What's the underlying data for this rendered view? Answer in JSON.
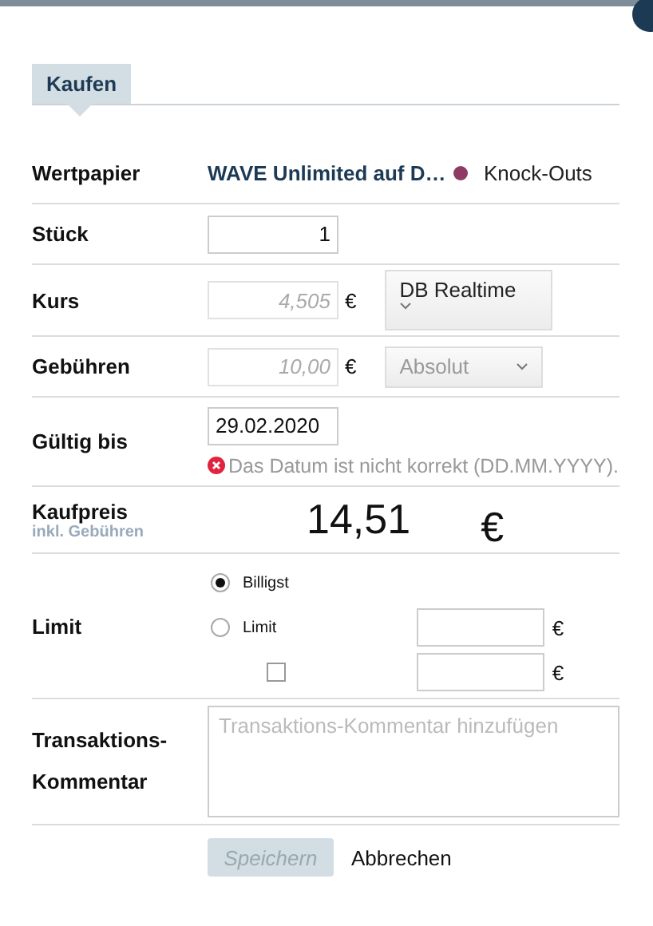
{
  "tabs": [
    {
      "label": "Kaufen",
      "selected": true
    }
  ],
  "security": {
    "label": "Wertpapier",
    "name": "WAVE Unlimited auf D…",
    "category": "Knock-Outs",
    "color": "#8e3a63"
  },
  "quantity": {
    "label": "Stück",
    "value": "1"
  },
  "price": {
    "label": "Kurs",
    "value": "4,505",
    "currency": "€",
    "disabled": true,
    "source": "DB Realtime"
  },
  "fees": {
    "label": "Gebühren",
    "value": "10,00",
    "currency": "€",
    "disabled": true,
    "mode": "Absolut"
  },
  "valid_until": {
    "label": "Gültig bis",
    "value": "29.02.2020",
    "error": "Das Datum ist nicht korrekt (DD.MM.YYYY)."
  },
  "total": {
    "label": "Kaufpreis",
    "sublabel": "inkl. Gebühren",
    "value": "14,51",
    "currency": "€"
  },
  "limit": {
    "label": "Limit",
    "options": [
      {
        "label": "Billigst",
        "selected": true
      },
      {
        "label": "Limit",
        "selected": false
      }
    ],
    "limit_currency": "€",
    "stop": {
      "checked": false,
      "currency": "€"
    }
  },
  "comment": {
    "label": "Transaktions-Kommentar",
    "placeholder": "Transaktions-Kommentar hinzufügen"
  },
  "buttons": [
    {
      "label": "Speichern",
      "kind": "primary",
      "disabled": true
    },
    {
      "label": "Abbrechen",
      "kind": "link",
      "disabled": false
    }
  ]
}
